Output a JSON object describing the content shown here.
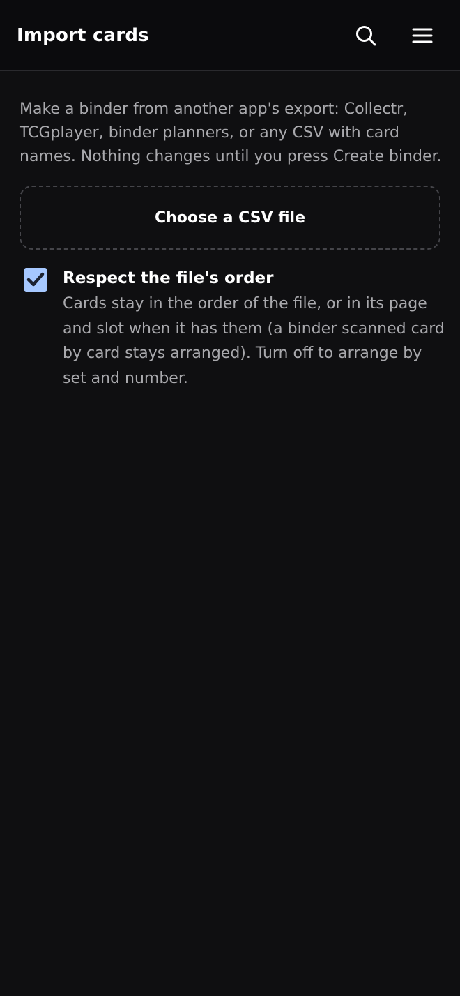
{
  "header": {
    "title": "Import cards",
    "search_icon": "search-icon",
    "menu_icon": "hamburger-menu-icon"
  },
  "intro": {
    "text": "Make a binder from another app's export: Collectr, TCGplayer, binder planners, or any CSV with card names. Nothing changes until you press Create binder."
  },
  "file_picker": {
    "label": "Choose a CSV file"
  },
  "respect_order": {
    "checked": true,
    "title": "Respect the file's order",
    "description": "Cards stay in the order of the file, or in its page and slot when it has them (a binder scanned card by card stays arranged). Turn off to arrange by set and number."
  },
  "colors": {
    "background": "#0f0f11",
    "header_background": "#0b0b0d",
    "checkbox_fill": "#a6c8ff",
    "muted_text": "#a9a9ad"
  }
}
